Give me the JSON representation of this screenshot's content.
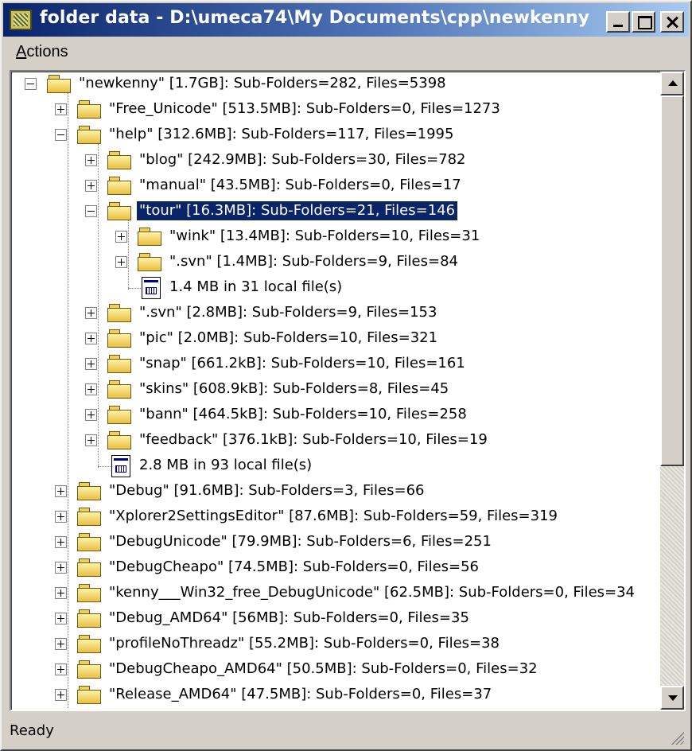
{
  "window": {
    "title": "folder data - D:\\umeca74\\My Documents\\cpp\\newkenny"
  },
  "menu": {
    "actions_label": "Actions"
  },
  "tree": {
    "rows": [
      {
        "label": "\"newkenny\" [1.7GB]: Sub-Folders=282, Files=5398"
      },
      {
        "label": "\"Free_Unicode\" [513.5MB]: Sub-Folders=0, Files=1273"
      },
      {
        "label": "\"help\" [312.6MB]: Sub-Folders=117, Files=1995"
      },
      {
        "label": "\"blog\" [242.9MB]: Sub-Folders=30, Files=782"
      },
      {
        "label": "\"manual\" [43.5MB]: Sub-Folders=0, Files=17"
      },
      {
        "label": "\"tour\" [16.3MB]: Sub-Folders=21, Files=146"
      },
      {
        "label": "\"wink\" [13.4MB]: Sub-Folders=10, Files=31"
      },
      {
        "label": "\".svn\" [1.4MB]: Sub-Folders=9, Files=84"
      },
      {
        "label": "1.4 MB in 31 local file(s)"
      },
      {
        "label": "\".svn\" [2.8MB]: Sub-Folders=9, Files=153"
      },
      {
        "label": "\"pic\" [2.0MB]: Sub-Folders=10, Files=321"
      },
      {
        "label": "\"snap\" [661.2kB]: Sub-Folders=10, Files=161"
      },
      {
        "label": "\"skins\" [608.9kB]: Sub-Folders=8, Files=45"
      },
      {
        "label": "\"bann\" [464.5kB]: Sub-Folders=10, Files=258"
      },
      {
        "label": "\"feedback\" [376.1kB]: Sub-Folders=10, Files=19"
      },
      {
        "label": "2.8 MB in 93 local file(s)"
      },
      {
        "label": "\"Debug\" [91.6MB]: Sub-Folders=3, Files=66"
      },
      {
        "label": "\"Xplorer2SettingsEditor\" [87.6MB]: Sub-Folders=59, Files=319"
      },
      {
        "label": "\"DebugUnicode\" [79.9MB]: Sub-Folders=6, Files=251"
      },
      {
        "label": "\"DebugCheapo\" [74.5MB]: Sub-Folders=0, Files=56"
      },
      {
        "label": "\"kenny___Win32_free_DebugUnicode\" [62.5MB]: Sub-Folders=0, Files=34"
      },
      {
        "label": "\"Debug_AMD64\" [56MB]: Sub-Folders=0, Files=35"
      },
      {
        "label": "\"profileNoThreadz\" [55.2MB]: Sub-Folders=0, Files=38"
      },
      {
        "label": "\"DebugCheapo_AMD64\" [50.5MB]: Sub-Folders=0, Files=32"
      },
      {
        "label": "\"Release_AMD64\" [47.5MB]: Sub-Folders=0, Files=37"
      }
    ]
  },
  "status": {
    "text": "Ready"
  }
}
